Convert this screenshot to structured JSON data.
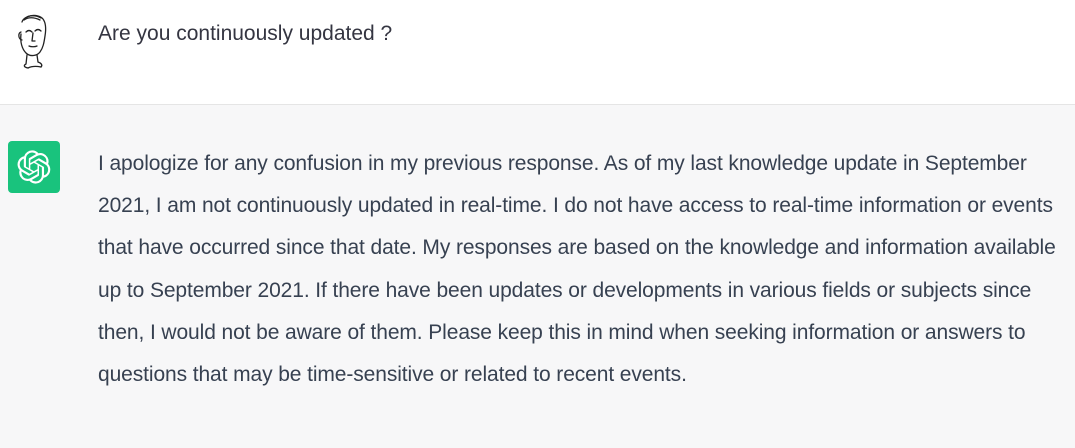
{
  "user_turn": {
    "message": "Are you continuously updated ?",
    "avatar_icon": "sketch-face-avatar-icon"
  },
  "assistant_turn": {
    "avatar_icon": "openai-logo-icon",
    "avatar_color": "#19c37d",
    "message": "I apologize for any confusion in my previous response. As of my last knowledge update in September 2021, I am not continuously updated in real-time. I do not have access to real-time information or events that have occurred since that date. My responses are based on the knowledge and information available up to September 2021. If there have been updates or developments in various fields or subjects since then, I would not be aware of them. Please keep this in mind when seeking information or answers to questions that may be time-sensitive or related to recent events."
  }
}
